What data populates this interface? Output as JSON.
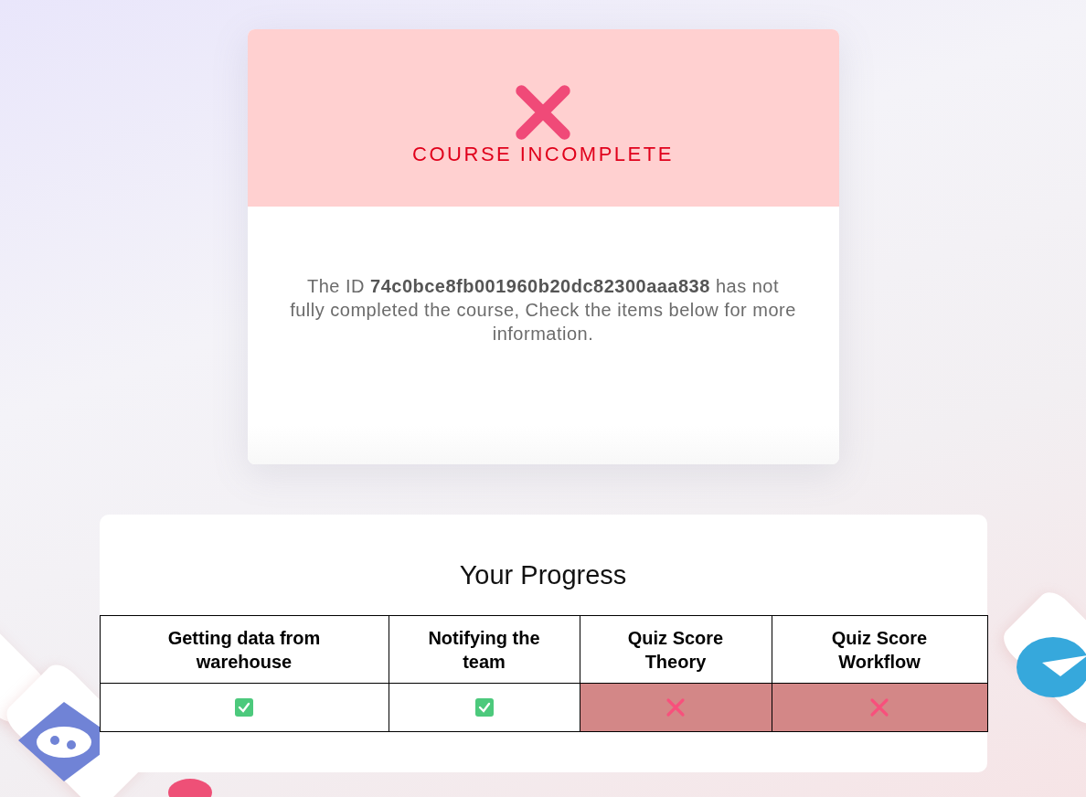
{
  "status": {
    "kind": "incomplete",
    "title": "COURSE INCOMPLETE",
    "message": "The ID **74c0bce8fb001960b20dc82300aaa838** has not fully completed the course, Check the items below for more information."
  },
  "progress": {
    "title": "Your Progress",
    "items": [
      {
        "label": "Getting data from warehouse",
        "passed": true
      },
      {
        "label": "Notifying the team",
        "passed": true
      },
      {
        "label": "Quiz Score Theory",
        "passed": false
      },
      {
        "label": "Quiz Score Workflow",
        "passed": false
      }
    ]
  }
}
